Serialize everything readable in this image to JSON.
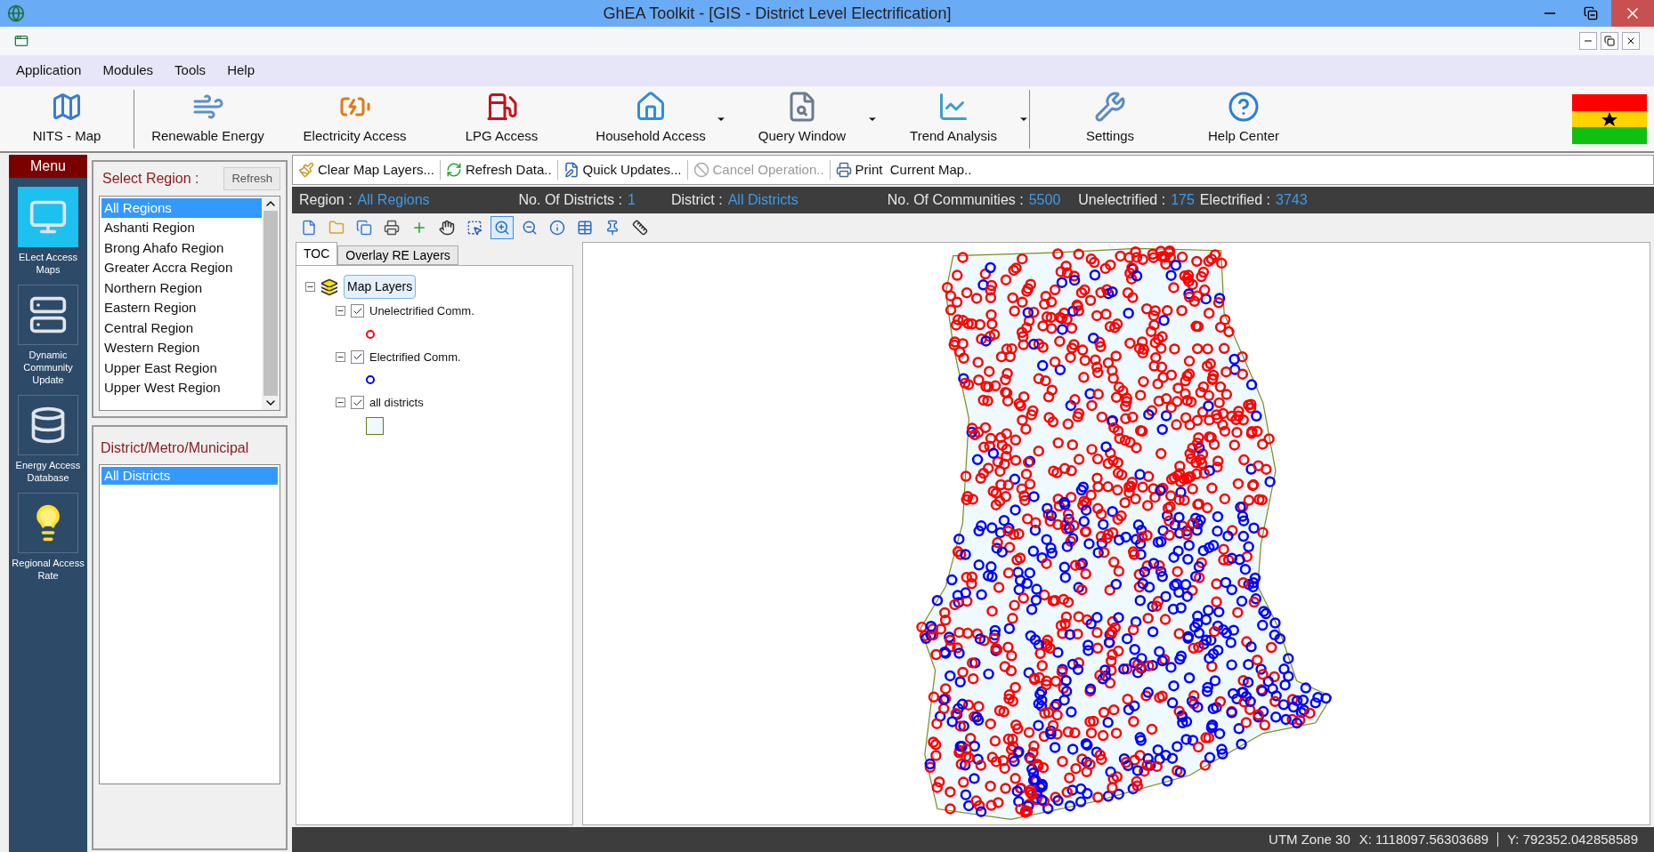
{
  "window": {
    "title": "GhEA Toolkit - [GIS - District Level Electrification]"
  },
  "menu": [
    "Application",
    "Modules",
    "Tools",
    "Help"
  ],
  "toolbar": [
    {
      "kind": "map",
      "label": "NITS - Map",
      "dropdown": false
    },
    {
      "kind": "windmill",
      "label": "Renewable Energy",
      "dropdown": false
    },
    {
      "kind": "battery",
      "label": "Electricity Access",
      "dropdown": false
    },
    {
      "kind": "fuel",
      "label": "LPG Access",
      "dropdown": false
    },
    {
      "kind": "house",
      "label": "Household Access",
      "dropdown": true
    },
    {
      "kind": "query",
      "label": "Query Window",
      "dropdown": true
    },
    {
      "kind": "trend",
      "label": "Trend Analysis",
      "dropdown": true
    },
    {
      "kind": "settings",
      "label": "Settings",
      "dropdown": false
    },
    {
      "kind": "help",
      "label": "Help Center",
      "dropdown": false
    }
  ],
  "nav": {
    "title": "Menu",
    "items": [
      {
        "kind": "monitor",
        "label": "ELect Access Maps",
        "selected": true
      },
      {
        "kind": "server",
        "label": "Dynamic Community Update",
        "selected": false
      },
      {
        "kind": "database",
        "label": "Energy Access Database",
        "selected": false
      },
      {
        "kind": "bulb",
        "label": "Regional Access Rate",
        "selected": false
      }
    ]
  },
  "region_panel": {
    "title": "Select Region :",
    "refresh": "Refresh",
    "items": [
      {
        "label": "All Regions",
        "selected": true
      },
      {
        "label": "Ashanti Region",
        "selected": false
      },
      {
        "label": "Brong Ahafo Region",
        "selected": false
      },
      {
        "label": "Greater Accra Region",
        "selected": false
      },
      {
        "label": "Northern Region",
        "selected": false
      },
      {
        "label": "Eastern Region",
        "selected": false
      },
      {
        "label": "Central Region",
        "selected": false
      },
      {
        "label": "Western Region",
        "selected": false
      },
      {
        "label": "Upper East Region",
        "selected": false
      },
      {
        "label": "Upper West Region",
        "selected": false
      }
    ]
  },
  "district_panel": {
    "title": "District/Metro/Municipal",
    "items": [
      {
        "label": "All Districts",
        "selected": true
      }
    ]
  },
  "actions": [
    {
      "kind": "brush",
      "label": "Clear Map Layers...",
      "disabled": false
    },
    {
      "kind": "refresh",
      "label": "Refresh Data..",
      "disabled": false
    },
    {
      "kind": "edit",
      "label": "Quick Updates...",
      "disabled": false
    },
    {
      "kind": "cancel",
      "label": "Cancel Operation..",
      "disabled": true
    },
    {
      "kind": "print",
      "label": "Print  Current Map..",
      "disabled": false
    }
  ],
  "info_bar": [
    {
      "label": "Region :",
      "value": "All Regions"
    },
    {
      "label": "No. Of Districts :",
      "value": "1"
    },
    {
      "label": "District :",
      "value": "All Districts"
    },
    {
      "label": "No. Of Communities :",
      "value": "5500"
    },
    {
      "label": "Unelectrified :",
      "value": "175"
    },
    {
      "label": "Electrified :",
      "value": "3743"
    }
  ],
  "map_tools": [
    {
      "kind": "new",
      "selected": false
    },
    {
      "kind": "open",
      "selected": false
    },
    {
      "kind": "copy",
      "selected": false
    },
    {
      "kind": "print",
      "selected": false
    },
    {
      "kind": "add",
      "selected": false
    },
    {
      "kind": "pan",
      "selected": false
    },
    {
      "kind": "select",
      "selected": false
    },
    {
      "kind": "zoomin",
      "selected": true
    },
    {
      "kind": "zoomout",
      "selected": false
    },
    {
      "kind": "info",
      "selected": false
    },
    {
      "kind": "table",
      "selected": false
    },
    {
      "kind": "pin",
      "selected": false
    },
    {
      "kind": "measure",
      "selected": false
    }
  ],
  "toc": {
    "tabs": [
      {
        "label": "TOC",
        "selected": true
      },
      {
        "label": "Overlay RE Layers",
        "selected": false
      }
    ],
    "root": {
      "label": "Map Layers",
      "expanded": true,
      "children": [
        {
          "label": "Unelectrified Comm.",
          "checked": true,
          "expanded": true,
          "kind": "red-circle"
        },
        {
          "label": "Electrified Comm.",
          "checked": true,
          "expanded": true,
          "kind": "blue-circle"
        },
        {
          "label": "all districts",
          "checked": true,
          "expanded": true,
          "kind": "polygon"
        }
      ]
    }
  },
  "status_bar": {
    "zone": "UTM Zone 30",
    "x": "X: 1118097.56303689",
    "y": "Y: 792352.042858589"
  }
}
